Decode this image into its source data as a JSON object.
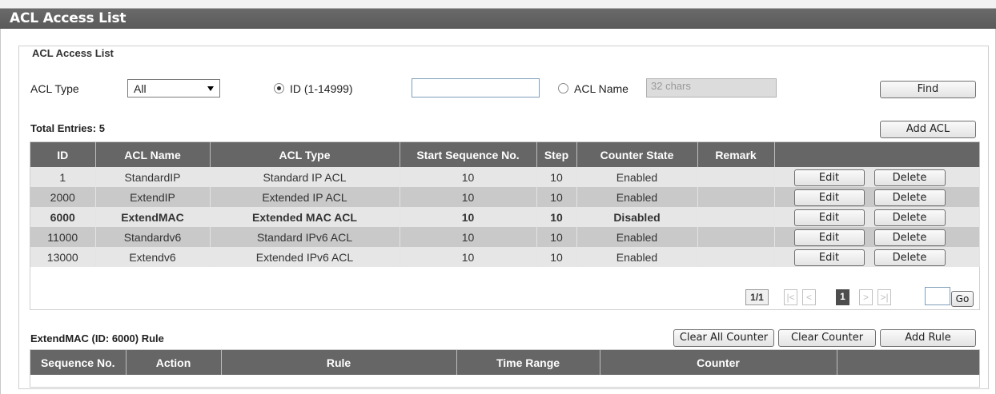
{
  "page": {
    "title": "ACL Access List"
  },
  "group": {
    "legend": "ACL Access List"
  },
  "filter": {
    "acl_type_label": "ACL Type",
    "acl_type_value": "All",
    "id_radio_label": "ID (1-14999)",
    "id_value": "",
    "name_radio_label": "ACL Name",
    "name_placeholder": "32 chars",
    "find_label": "Find"
  },
  "list": {
    "total_entries": "Total Entries: 5",
    "add_label": "Add ACL",
    "columns": [
      "ID",
      "ACL Name",
      "ACL Type",
      "Start Sequence No.",
      "Step",
      "Counter State",
      "Remark",
      ""
    ],
    "rows": [
      {
        "id": "1",
        "name": "StandardIP",
        "type": "Standard IP ACL",
        "start_seq": "10",
        "step": "10",
        "counter_state": "Enabled",
        "remark": "",
        "edit": "Edit",
        "delete": "Delete"
      },
      {
        "id": "2000",
        "name": "ExtendIP",
        "type": "Extended IP ACL",
        "start_seq": "10",
        "step": "10",
        "counter_state": "Enabled",
        "remark": "",
        "edit": "Edit",
        "delete": "Delete"
      },
      {
        "id": "6000",
        "name": "ExtendMAC",
        "type": "Extended MAC ACL",
        "start_seq": "10",
        "step": "10",
        "counter_state": "Disabled",
        "remark": "",
        "edit": "Edit",
        "delete": "Delete"
      },
      {
        "id": "11000",
        "name": "Standardv6",
        "type": "Standard IPv6 ACL",
        "start_seq": "10",
        "step": "10",
        "counter_state": "Enabled",
        "remark": "",
        "edit": "Edit",
        "delete": "Delete"
      },
      {
        "id": "13000",
        "name": "Extendv6",
        "type": "Extended IPv6 ACL",
        "start_seq": "10",
        "step": "10",
        "counter_state": "Enabled",
        "remark": "",
        "edit": "Edit",
        "delete": "Delete"
      }
    ],
    "selected_row": 2
  },
  "pagination": {
    "page_count": "1/1",
    "first": "|<",
    "prev": "<",
    "current": "1",
    "next": ">",
    "last": ">|",
    "go_label": "Go",
    "go_value": ""
  },
  "rules": {
    "title": "ExtendMAC (ID: 6000) Rule",
    "clear_all_label": "Clear All Counter",
    "clear_label": "Clear Counter",
    "add_label": "Add Rule",
    "columns": [
      "Sequence No.",
      "Action",
      "Rule",
      "Time Range",
      "Counter",
      ""
    ]
  },
  "colors": {
    "title_bar": "#5a5a5a",
    "table_header": "#666666",
    "row_odd": "#e6e6e6",
    "row_even": "#c9c9c9"
  }
}
